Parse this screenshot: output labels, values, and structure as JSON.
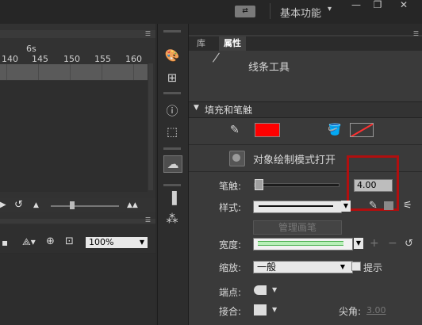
{
  "topbar": {
    "workspace_icon": "workspace-switch-icon",
    "workspace_label": "基本功能",
    "workspace_arrow": "▾",
    "minimize": "—",
    "restore": "❐",
    "close": "✕"
  },
  "timeline": {
    "marker": "6s",
    "ticks": [
      "140",
      "145",
      "150",
      "155",
      "160"
    ],
    "zoom_value": "100%"
  },
  "properties": {
    "tab_library": "库",
    "tab_properties": "属性",
    "tool_name": "线条工具",
    "section_title": "填充和笔触",
    "stroke_color": "#ff0000",
    "object_drawing_label": "对象绘制模式打开",
    "stroke_label": "笔触:",
    "stroke_value": "4.00",
    "style_label": "样式:",
    "manage_brush_label": "管理画笔",
    "width_label": "宽度:",
    "scale_label": "缩放:",
    "scale_value": "一般",
    "hint_label": "提示",
    "cap_label": "端点:",
    "join_label": "接合:",
    "miter_label": "尖角:",
    "miter_value": "3.00"
  }
}
